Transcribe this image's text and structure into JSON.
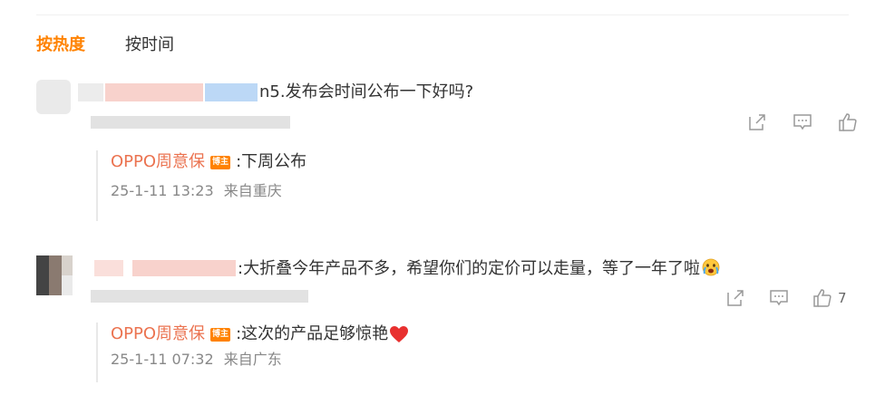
{
  "sort_tabs": {
    "active_label": "按热度",
    "inactive_label": "按时间"
  },
  "colors": {
    "accent_orange": "#ff8200",
    "author_link": "#eb7350",
    "meta_gray": "#888888",
    "icon_gray": "#999999",
    "heart_red": "#e8302f"
  },
  "comments": [
    {
      "text": "n5.发布会时间公布一下好吗?",
      "actions": {
        "share_icon": "share-icon",
        "comment_icon": "comment-icon",
        "like_icon": "like-icon",
        "like_count": ""
      },
      "reply": {
        "author": "OPPO周意保",
        "badge": "博主",
        "text": ":下周公布",
        "date": "25-1-11 13:23",
        "location": "来自重庆"
      }
    },
    {
      "text": ":大折叠今年产品不多，希望你们的定价可以走量，等了一年了啦",
      "emoji": "crying-emoji",
      "actions": {
        "share_icon": "share-icon",
        "comment_icon": "comment-icon",
        "like_icon": "like-icon",
        "like_count": "7"
      },
      "reply": {
        "author": "OPPO周意保",
        "badge": "博主",
        "text": ":这次的产品足够惊艳",
        "emoji": "red-heart",
        "date": "25-1-11 07:32",
        "location": "来自广东"
      }
    }
  ]
}
